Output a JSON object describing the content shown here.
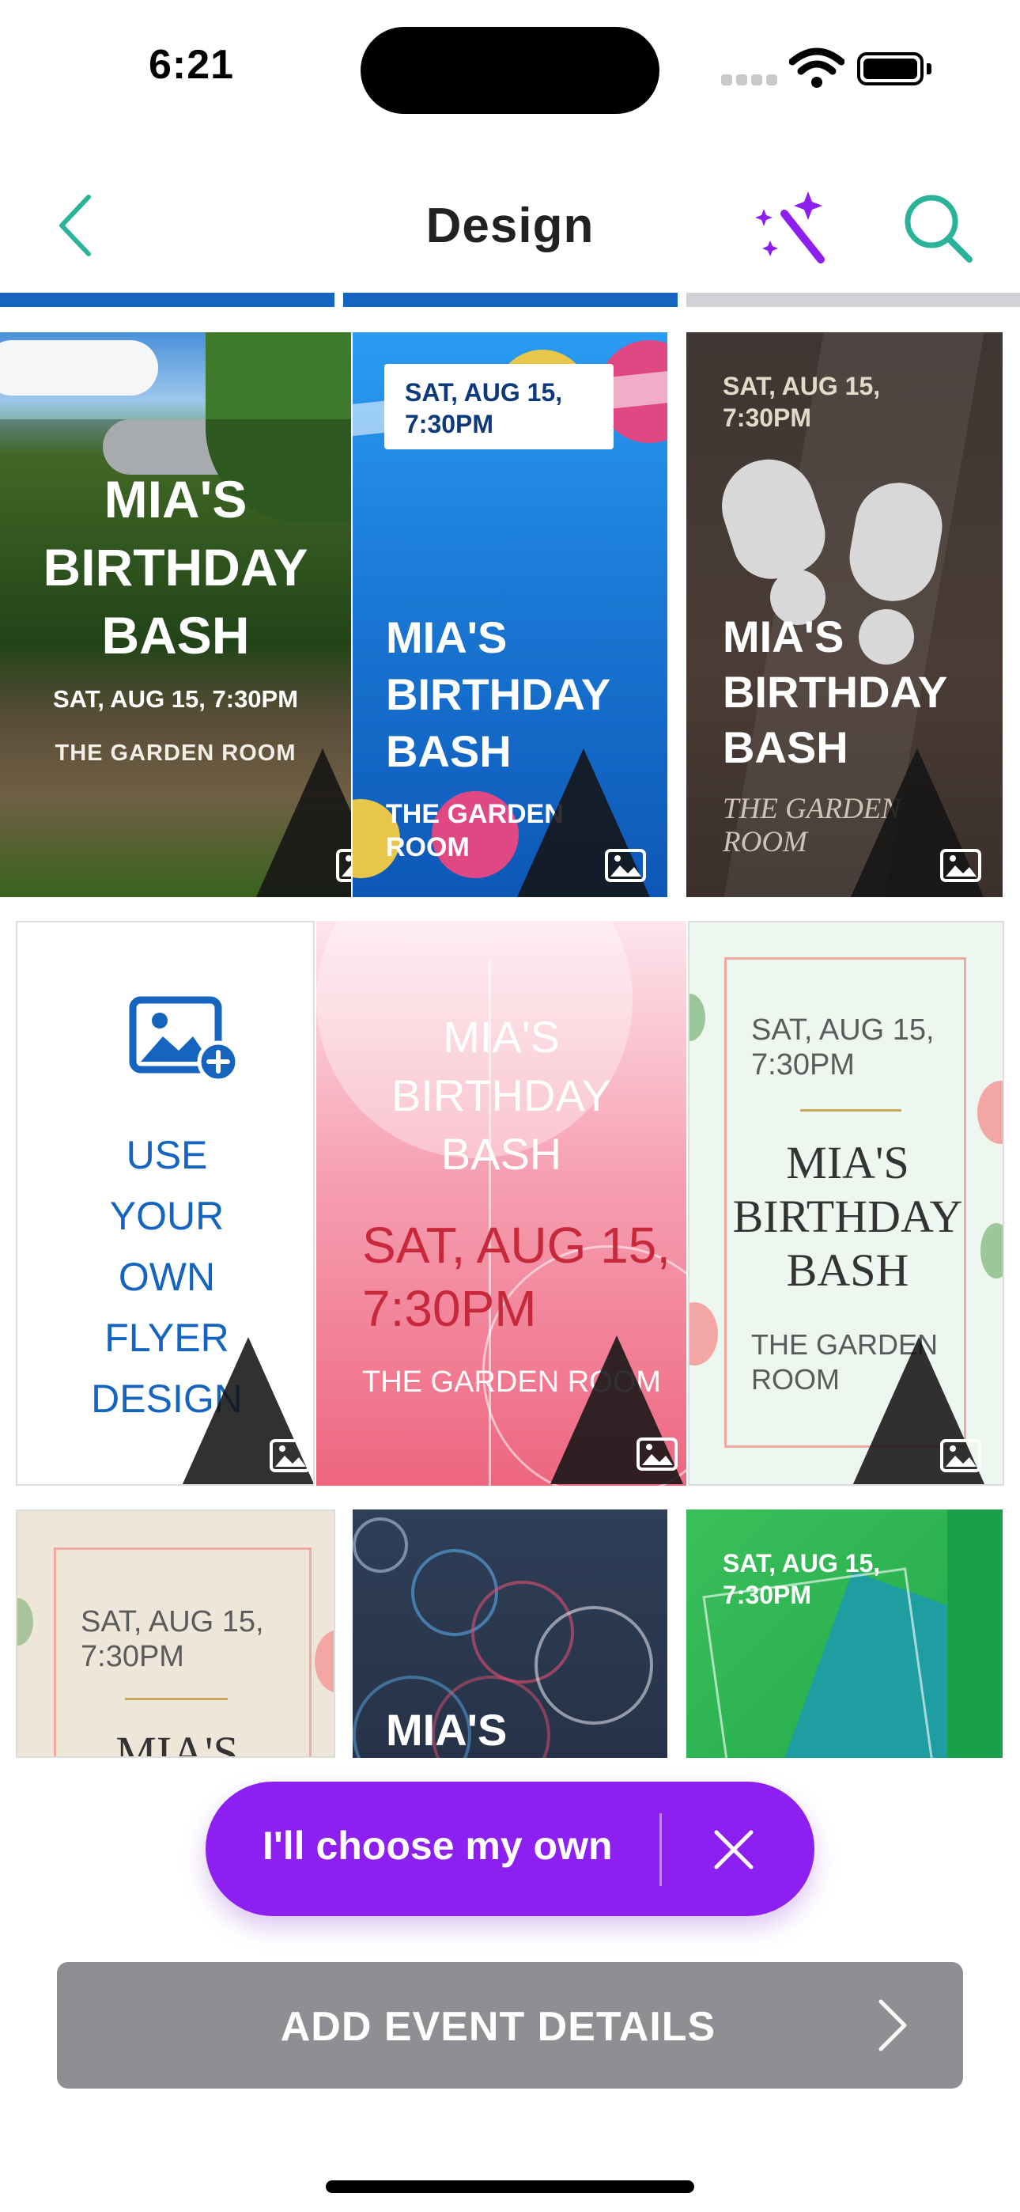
{
  "status_bar": {
    "time": "6:21"
  },
  "header": {
    "title": "Design"
  },
  "progress": {
    "total_steps": 3,
    "completed_steps": 2,
    "active_color": "#1565c0",
    "inactive_color": "#d1d1d6"
  },
  "icons": {
    "back": "chevron-left-icon",
    "magic": "magic-wand-icon",
    "search": "search-icon",
    "photo": "image-icon",
    "add_photo": "add-photo-icon",
    "close": "close-icon",
    "next": "chevron-right-icon"
  },
  "templates": {
    "t1": {
      "title_lines": [
        "MIA'S",
        "BIRTHDAY",
        "BASH"
      ],
      "date": "SAT, AUG 15, 7:30PM",
      "venue": "THE GARDEN ROOM"
    },
    "t2": {
      "date_lines": [
        "SAT, AUG 15,",
        "7:30PM"
      ],
      "title_lines": [
        "MIA'S",
        "BIRTHDAY",
        "BASH"
      ],
      "venue_lines": [
        "THE GARDEN",
        "ROOM"
      ]
    },
    "t3": {
      "date_lines": [
        "SAT, AUG 15,",
        "7:30PM"
      ],
      "title_lines": [
        "MIA'S",
        "BIRTHDAY",
        "BASH"
      ],
      "venue_lines": [
        "THE GARDEN",
        "ROOM"
      ]
    },
    "own_design": {
      "lines": [
        "USE",
        "YOUR",
        "OWN",
        "FLYER",
        "DESIGN"
      ]
    },
    "t5": {
      "title_lines": [
        "MIA'S",
        "BIRTHDAY",
        "BASH"
      ],
      "date_lines": [
        "SAT, AUG 15,",
        "7:30PM"
      ],
      "venue": "THE GARDEN ROOM"
    },
    "t6": {
      "date_lines": [
        "SAT, AUG 15,",
        "7:30PM"
      ],
      "title_lines": [
        "MIA'S",
        "BIRTHDAY",
        "BASH"
      ],
      "venue_lines": [
        "THE GARDEN",
        "ROOM"
      ]
    },
    "t7": {
      "date_lines": [
        "SAT, AUG 15,",
        "7:30PM"
      ],
      "title_partial": "MIA'S"
    },
    "t8": {
      "title_partial": "MIA'S"
    },
    "t9": {
      "date_lines": [
        "SAT, AUG 15,",
        "7:30PM"
      ]
    }
  },
  "choose_own": {
    "label": "I'll choose my own"
  },
  "primary_action": {
    "label": "ADD EVENT DETAILS"
  },
  "colors": {
    "accent_teal": "#2bb39a",
    "brand_blue": "#1565c0",
    "purple": "#8d1ff0",
    "disabled_gray": "#8e8e93"
  }
}
